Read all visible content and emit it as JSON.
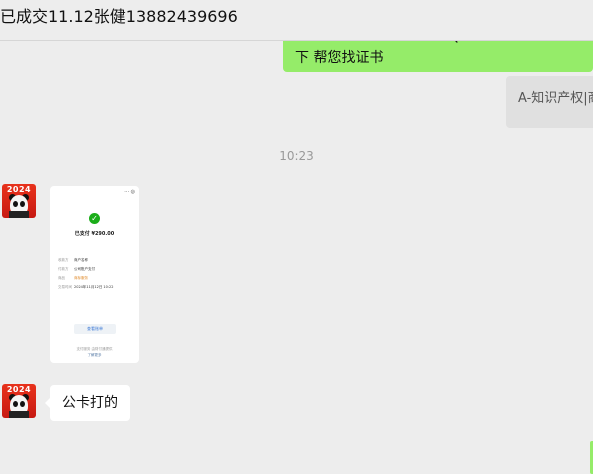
{
  "header": {
    "title": "已成交11.12张健13882439696"
  },
  "messages": {
    "sent_green_text": "下 帮您找证书",
    "sent_green_cut": "、",
    "sent_grey_text": "A-知识产权|商",
    "time_separator": "10:23",
    "received_text": "公卡打的"
  },
  "avatar": {
    "year": "2024"
  },
  "receipt": {
    "amount": "已支付 ¥290.00",
    "rows": [
      {
        "label": "收款方",
        "value": "商户名称"
      },
      {
        "label": "付款方",
        "value": "公司账户支付"
      },
      {
        "label": "商品",
        "value": "商标服务"
      },
      {
        "label": "交易时间",
        "value": "2024年11月12日 10:22"
      }
    ],
    "button_label": "查看账单",
    "footer": "支付服务 由财付通提供",
    "footer_link": "了解更多"
  },
  "colors": {
    "background": "#ededed",
    "sent_bubble": "#95ec69",
    "received_bubble": "#ffffff",
    "success": "#1aad19"
  }
}
